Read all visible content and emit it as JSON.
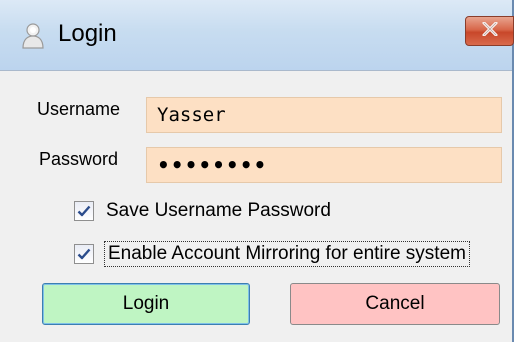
{
  "window": {
    "title": "Login",
    "close_symbol": "✕",
    "icon": "user-icon"
  },
  "form": {
    "username_label": "Username",
    "username_value": "Yasser",
    "password_label": "Password",
    "password_value": "••••••••"
  },
  "options": {
    "save_label": "Save Username Password",
    "save_checked": true,
    "mirror_label": "Enable Account Mirroring for entire system",
    "mirror_checked": true
  },
  "buttons": {
    "login_label": "Login",
    "cancel_label": "Cancel"
  },
  "colors": {
    "input_background": "#fde0c4",
    "login_button": "#bff5c3",
    "cancel_button": "#ffc3c3",
    "close_button": "#d8674a"
  }
}
